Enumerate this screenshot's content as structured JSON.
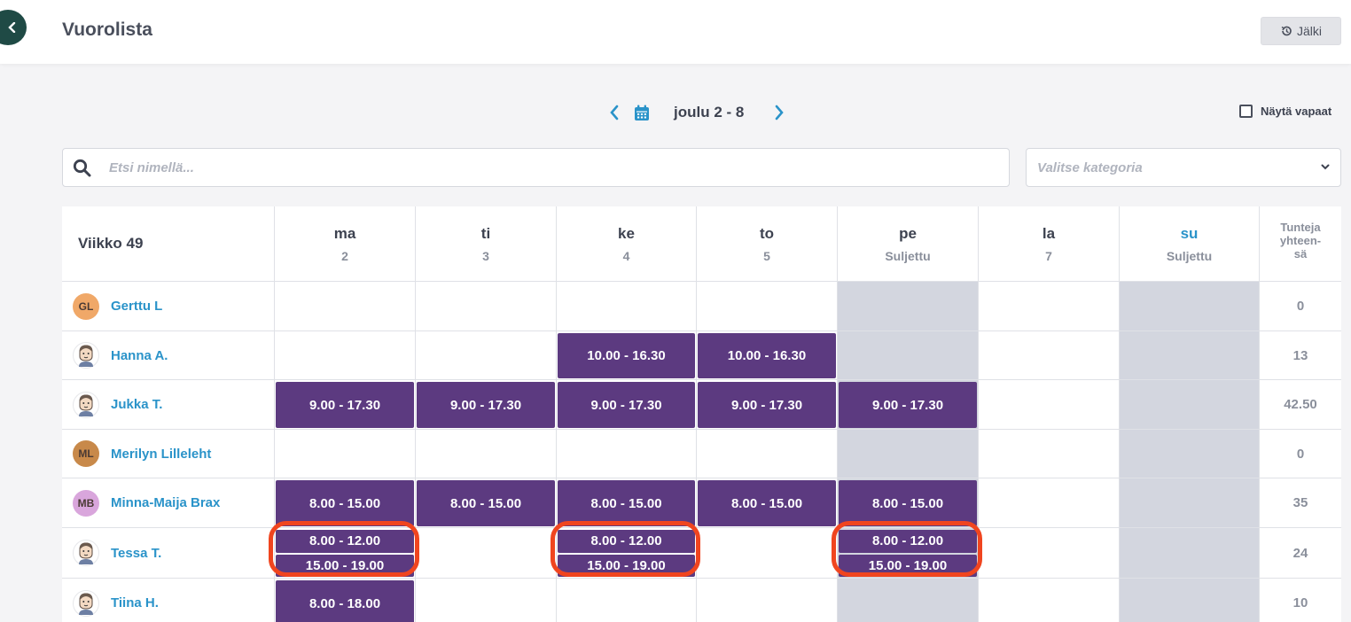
{
  "header": {
    "title": "Vuorolista",
    "history_label": "Jälki"
  },
  "week_nav": {
    "label": "joulu 2 - 8",
    "show_free_label": "Näytä vapaat"
  },
  "search": {
    "placeholder": "Etsi nimellä..."
  },
  "category": {
    "placeholder": "Valitse kategoria"
  },
  "table": {
    "week_title": "Viikko 49",
    "total_header": [
      "Tunteja",
      "yhteen-",
      "sä"
    ],
    "days": [
      {
        "name": "ma",
        "sub": "2",
        "closed": false
      },
      {
        "name": "ti",
        "sub": "3",
        "closed": false
      },
      {
        "name": "ke",
        "sub": "4",
        "closed": false
      },
      {
        "name": "to",
        "sub": "5",
        "closed": false
      },
      {
        "name": "pe",
        "sub": "Suljettu",
        "closed": true
      },
      {
        "name": "la",
        "sub": "7",
        "closed": false
      },
      {
        "name": "su",
        "sub": "Suljettu",
        "closed": true
      }
    ],
    "employees": [
      {
        "name": "Gerttu L",
        "initials": "GL",
        "avatar_color": "#f0a868",
        "total": "0",
        "shifts": [
          [],
          [],
          [],
          [],
          [],
          [],
          []
        ]
      },
      {
        "name": "Hanna A.",
        "initials": "",
        "avatar_color": "",
        "total": "13",
        "shifts": [
          [],
          [],
          [
            "10.00 - 16.30"
          ],
          [
            "10.00 - 16.30"
          ],
          [],
          [],
          []
        ]
      },
      {
        "name": "Jukka T.",
        "initials": "",
        "avatar_color": "",
        "total": "42.50",
        "shifts": [
          [
            "9.00 - 17.30"
          ],
          [
            "9.00 - 17.30"
          ],
          [
            "9.00 - 17.30"
          ],
          [
            "9.00 - 17.30"
          ],
          [
            "9.00 - 17.30"
          ],
          [],
          []
        ]
      },
      {
        "name": "Merilyn Lilleleht",
        "initials": "ML",
        "avatar_color": "#c8894a",
        "total": "0",
        "shifts": [
          [],
          [],
          [],
          [],
          [],
          [],
          []
        ]
      },
      {
        "name": "Minna-Maija Brax",
        "initials": "MB",
        "avatar_color": "#d9a6dc",
        "total": "35",
        "shifts": [
          [
            "8.00 - 15.00"
          ],
          [
            "8.00 - 15.00"
          ],
          [
            "8.00 - 15.00"
          ],
          [
            "8.00 - 15.00"
          ],
          [
            "8.00 - 15.00"
          ],
          [],
          []
        ]
      },
      {
        "name": "Tessa T.",
        "initials": "",
        "avatar_color": "",
        "total": "24",
        "shifts": [
          [
            "8.00 - 12.00",
            "15.00 - 19.00"
          ],
          [],
          [
            "8.00 - 12.00",
            "15.00 - 19.00"
          ],
          [],
          [
            "8.00 - 12.00",
            "15.00 - 19.00"
          ],
          [],
          []
        ]
      },
      {
        "name": "Tiina H.",
        "initials": "",
        "avatar_color": "",
        "total": "10",
        "shifts": [
          [
            "8.00 - 18.00"
          ],
          [],
          [],
          [],
          [],
          [],
          []
        ]
      }
    ]
  },
  "colors": {
    "shift": "#5c3a80",
    "closed": "#d3d6df",
    "link": "#2a93c9",
    "highlight": "#f0451f"
  },
  "icons": [
    "chevron-left-icon",
    "history-icon",
    "calendar-icon",
    "chevron-right-icon",
    "search-icon",
    "chevron-down-icon",
    "person-avatar-icon"
  ]
}
